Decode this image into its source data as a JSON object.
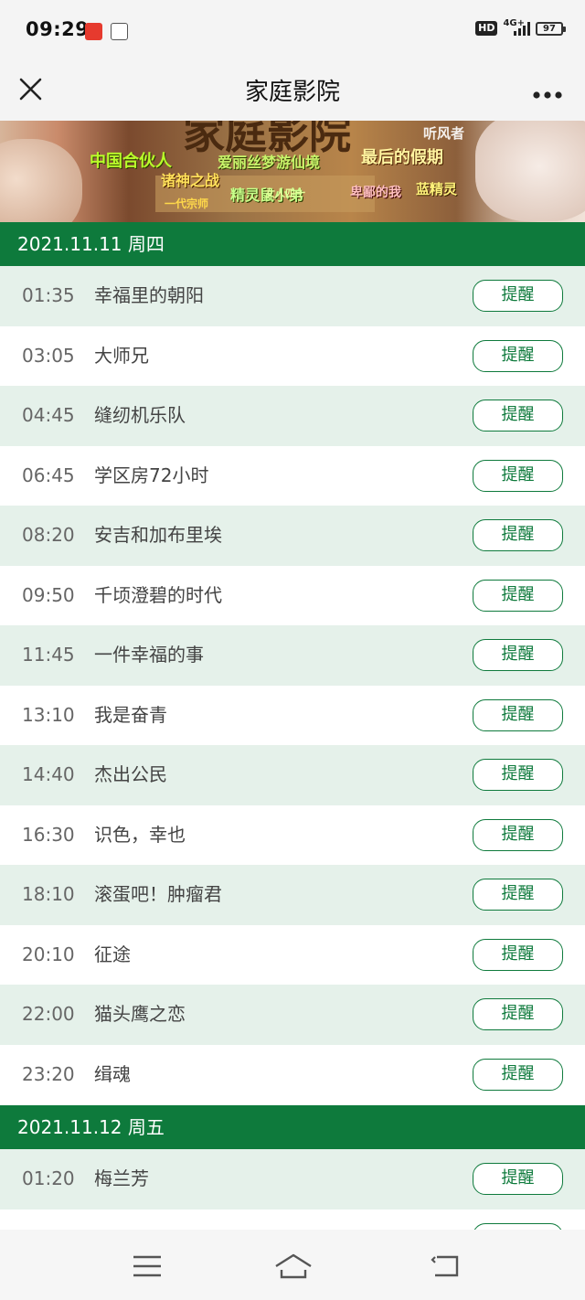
{
  "status_bar": {
    "time": "09:29",
    "hd_label": "HD",
    "network_label": "4G+",
    "battery_level": "97"
  },
  "header": {
    "title": "家庭影院",
    "close_icon": "close-icon",
    "more_icon": "more-icon"
  },
  "banner": {
    "texts": [
      "家庭影院",
      "中国合伙人",
      "爱丽丝梦游仙境",
      "最后的假期",
      "诸神之战",
      "精灵鼠小弟",
      "卑鄙的我",
      "蓝精灵",
      "听风者",
      "一代宗师",
      "女人四十"
    ]
  },
  "schedule": [
    {
      "date": "2021.11.11 周四",
      "programs": [
        {
          "time": "01:35",
          "title": "幸福里的朝阳"
        },
        {
          "time": "03:05",
          "title": "大师兄"
        },
        {
          "time": "04:45",
          "title": "缝纫机乐队"
        },
        {
          "time": "06:45",
          "title": "学区房72小时"
        },
        {
          "time": "08:20",
          "title": "安吉和加布里埃"
        },
        {
          "time": "09:50",
          "title": "千顷澄碧的时代"
        },
        {
          "time": "11:45",
          "title": "一件幸福的事"
        },
        {
          "time": "13:10",
          "title": "我是奋青"
        },
        {
          "time": "14:40",
          "title": "杰出公民"
        },
        {
          "time": "16:30",
          "title": "识色，幸也"
        },
        {
          "time": "18:10",
          "title": "滚蛋吧！肿瘤君"
        },
        {
          "time": "20:10",
          "title": "征途"
        },
        {
          "time": "22:00",
          "title": "猫头鹰之恋"
        },
        {
          "time": "23:20",
          "title": "缉魂"
        }
      ]
    },
    {
      "date": "2021.11.12 周五",
      "programs": [
        {
          "time": "01:20",
          "title": "梅兰芳"
        }
      ]
    }
  ],
  "remind_label": "提醒",
  "colors": {
    "accent": "#0e7a3c",
    "row_alt": "#e5f1ea",
    "bar_bg": "#f4f4f4"
  },
  "nav": {
    "menu_icon": "menu-icon",
    "home_icon": "home-icon",
    "back_icon": "back-icon"
  }
}
